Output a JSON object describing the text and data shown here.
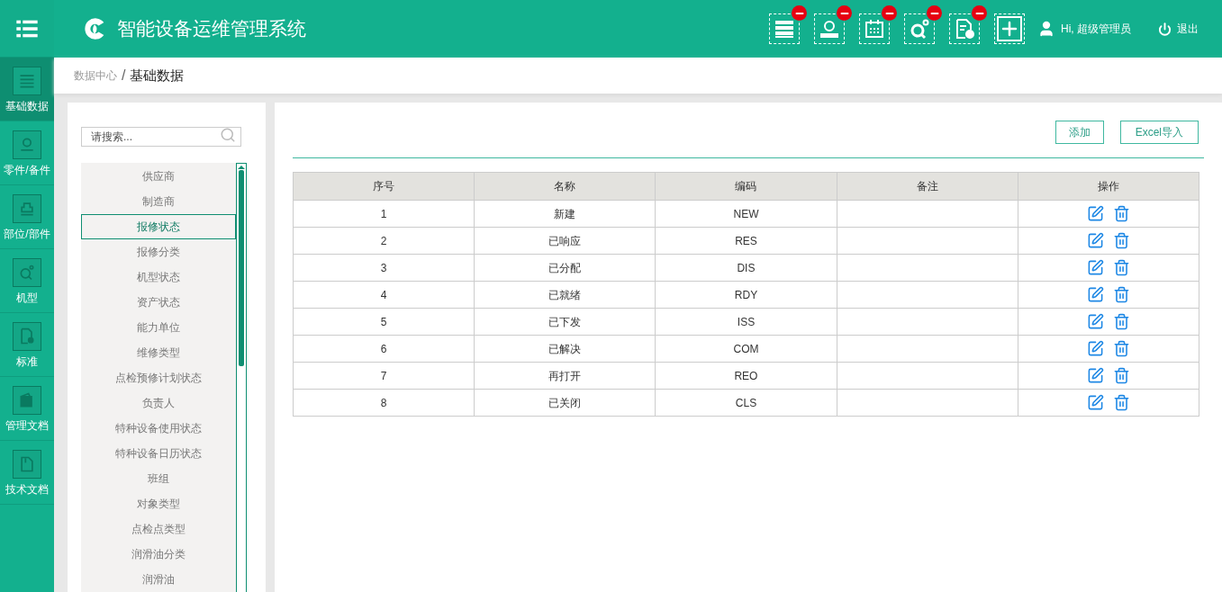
{
  "header": {
    "title": "智能设备运维管理系统",
    "shortcuts": [
      {
        "removable": true
      },
      {
        "removable": true
      },
      {
        "removable": true
      },
      {
        "removable": true
      },
      {
        "removable": true
      },
      {
        "removable": false
      }
    ],
    "user": "Hi, 超级管理员",
    "logout": "退出"
  },
  "sidebar": {
    "items": [
      {
        "label": "基础数据",
        "selected": true
      },
      {
        "label": "零件/备件",
        "selected": false
      },
      {
        "label": "部位/部件",
        "selected": false
      },
      {
        "label": "机型",
        "selected": false
      },
      {
        "label": "标准",
        "selected": false
      },
      {
        "label": "管理文档",
        "selected": false
      },
      {
        "label": "技术文档",
        "selected": false
      }
    ]
  },
  "breadcrumb": {
    "parent": "数据中心",
    "separator": "/",
    "current": "基础数据"
  },
  "search": {
    "placeholder": "请搜索..."
  },
  "categories": [
    {
      "label": "供应商",
      "selected": false
    },
    {
      "label": "制造商",
      "selected": false
    },
    {
      "label": "报修状态",
      "selected": true
    },
    {
      "label": "报修分类",
      "selected": false
    },
    {
      "label": "机型状态",
      "selected": false
    },
    {
      "label": "资产状态",
      "selected": false
    },
    {
      "label": "能力单位",
      "selected": false
    },
    {
      "label": "维修类型",
      "selected": false
    },
    {
      "label": "点检预修计划状态",
      "selected": false
    },
    {
      "label": "负责人",
      "selected": false
    },
    {
      "label": "特种设备使用状态",
      "selected": false
    },
    {
      "label": "特种设备日历状态",
      "selected": false
    },
    {
      "label": "班组",
      "selected": false
    },
    {
      "label": "对象类型",
      "selected": false
    },
    {
      "label": "点检点类型",
      "selected": false
    },
    {
      "label": "润滑油分类",
      "selected": false
    },
    {
      "label": "润滑油",
      "selected": false
    }
  ],
  "buttons": [
    "添加",
    "Excel导入"
  ],
  "table": {
    "columns": [
      "序号",
      "名称",
      "编码",
      "备注",
      "操作"
    ],
    "rows": [
      [
        "1",
        "新建",
        "NEW",
        ""
      ],
      [
        "2",
        "已响应",
        "RES",
        ""
      ],
      [
        "3",
        "已分配",
        "DIS",
        ""
      ],
      [
        "4",
        "已就绪",
        "RDY",
        ""
      ],
      [
        "5",
        "已下发",
        "ISS",
        ""
      ],
      [
        "6",
        "已解决",
        "COM",
        ""
      ],
      [
        "7",
        "再打开",
        "REO",
        ""
      ],
      [
        "8",
        "已关闭",
        "CLS",
        ""
      ]
    ]
  }
}
